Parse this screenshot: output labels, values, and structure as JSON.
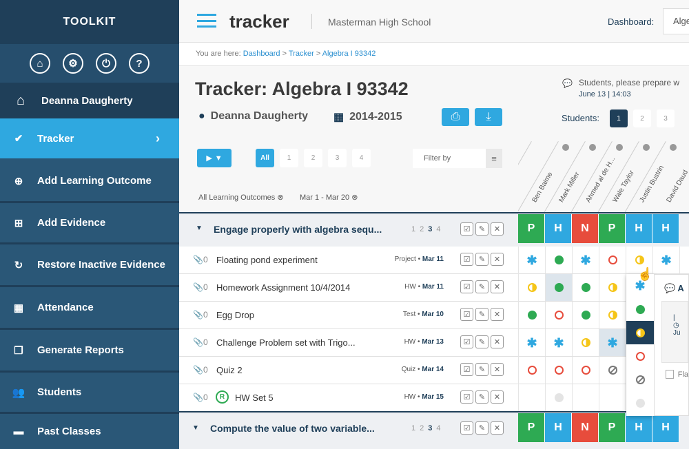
{
  "sidebar": {
    "title": "TOOLKIT",
    "user": "Deanna Daugherty",
    "items": [
      {
        "label": "Tracker",
        "icon": "check-icon"
      },
      {
        "label": "Add Learning Outcome",
        "icon": "plus-circle-icon"
      },
      {
        "label": "Add Evidence",
        "icon": "plus-square-icon"
      },
      {
        "label": "Restore Inactive Evidence",
        "icon": "refresh-icon"
      },
      {
        "label": "Attendance",
        "icon": "calendar-icon"
      },
      {
        "label": "Generate Reports",
        "icon": "copy-icon"
      },
      {
        "label": "Students",
        "icon": "users-icon"
      },
      {
        "label": "Past Classes",
        "icon": "folder-icon"
      }
    ]
  },
  "header": {
    "app": "tracker",
    "school": "Masterman High School",
    "dash_label": "Dashboard:",
    "dash_value": "Alge"
  },
  "breadcrumb": {
    "prefix": "You are here:",
    "items": [
      "Dashboard",
      "Tracker",
      "Algebra I 93342"
    ]
  },
  "page": {
    "title": "Tracker: Algebra I 93342",
    "teacher": "Deanna Daugherty",
    "year": "2014-2015"
  },
  "announce": {
    "text": "Students, please prepare w",
    "date": "June 13 | 14:03"
  },
  "students_label": "Students:",
  "student_pages": [
    "1",
    "2",
    "3"
  ],
  "filter": {
    "all": "All",
    "pages": [
      "1",
      "2",
      "3",
      "4"
    ],
    "placeholder": "Filter by",
    "tags": [
      "All Learning Outcomes",
      "Mar 1 - Mar 20"
    ]
  },
  "student_names": [
    "Ben Baime",
    "Mark Miller",
    "Ahmed al de H...",
    "Wale Taylor",
    "Justin Bustrin",
    "David Daud"
  ],
  "groups": [
    {
      "title": "Engage properly with algebra sequ...",
      "pages": [
        "1",
        "2",
        "3",
        "4"
      ],
      "grades": [
        "P",
        "H",
        "N",
        "P",
        "H",
        "H"
      ]
    },
    {
      "title": "Compute the value of two variable...",
      "pages": [
        "1",
        "2",
        "3",
        "4"
      ],
      "grades": [
        "P",
        "H",
        "N",
        "P",
        "H",
        "H"
      ]
    }
  ],
  "rows": [
    {
      "count": "0",
      "name": "Floating pond experiment",
      "type": "Project",
      "date": "Mar 11",
      "marks": [
        "star",
        "g",
        "star",
        "r",
        "half",
        "star"
      ]
    },
    {
      "count": "0",
      "name": "Homework Assignment 10/4/2014",
      "type": "HW",
      "date": "Mar 11",
      "marks": [
        "half",
        "g",
        "g",
        "half",
        "",
        ""
      ]
    },
    {
      "count": "0",
      "name": "Egg Drop",
      "type": "Test",
      "date": "Mar 10",
      "marks": [
        "g",
        "r",
        "g",
        "half",
        "",
        ""
      ]
    },
    {
      "count": "0",
      "name": "Challenge Problem set with Trigo...",
      "type": "HW",
      "date": "Mar 13",
      "marks": [
        "star",
        "star",
        "half",
        "star",
        "",
        ""
      ]
    },
    {
      "count": "0",
      "name": "Quiz 2",
      "type": "Quiz",
      "date": "Mar 14",
      "marks": [
        "r",
        "r",
        "r",
        "slash",
        "",
        ""
      ]
    },
    {
      "count": "0",
      "name": "HW Set 5",
      "type": "HW",
      "date": "Mar 15",
      "badge": "R",
      "marks": [
        "",
        "gray",
        "",
        "",
        "",
        ""
      ]
    }
  ],
  "popup": {
    "letter": "A",
    "date": "Ju",
    "flag": "Fla"
  }
}
